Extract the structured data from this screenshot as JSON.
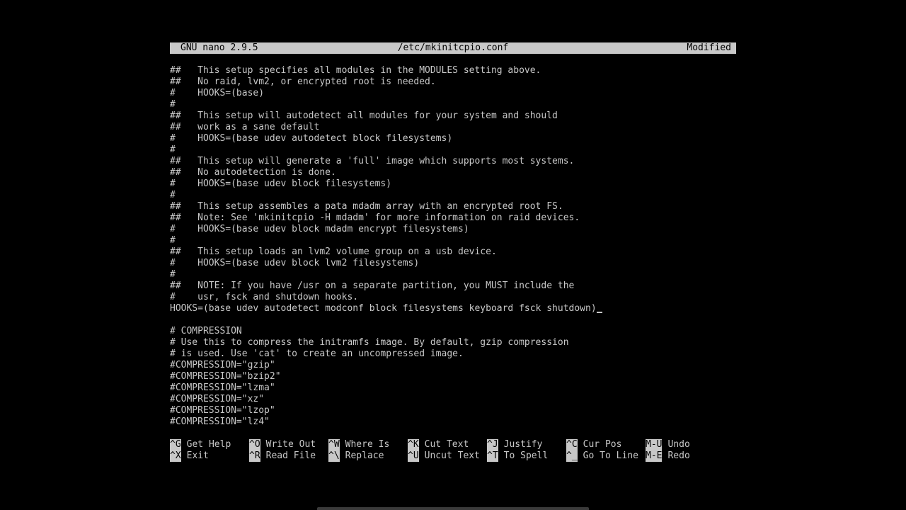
{
  "titlebar": {
    "app": "GNU nano 2.9.5",
    "file": "/etc/mkinitcpio.conf",
    "status": "Modified"
  },
  "editor": {
    "lines": [
      "##   This setup specifies all modules in the MODULES setting above.",
      "##   No raid, lvm2, or encrypted root is needed.",
      "#    HOOKS=(base)",
      "#",
      "##   This setup will autodetect all modules for your system and should",
      "##   work as a sane default",
      "#    HOOKS=(base udev autodetect block filesystems)",
      "#",
      "##   This setup will generate a 'full' image which supports most systems.",
      "##   No autodetection is done.",
      "#    HOOKS=(base udev block filesystems)",
      "#",
      "##   This setup assembles a pata mdadm array with an encrypted root FS.",
      "##   Note: See 'mkinitcpio -H mdadm' for more information on raid devices.",
      "#    HOOKS=(base udev block mdadm encrypt filesystems)",
      "#",
      "##   This setup loads an lvm2 volume group on a usb device.",
      "#    HOOKS=(base udev block lvm2 filesystems)",
      "#",
      "##   NOTE: If you have /usr on a separate partition, you MUST include the",
      "#    usr, fsck and shutdown hooks.",
      "HOOKS=(base udev autodetect modconf block filesystems keyboard fsck shutdown)",
      "",
      "# COMPRESSION",
      "# Use this to compress the initramfs image. By default, gzip compression",
      "# is used. Use 'cat' to create an uncompressed image.",
      "#COMPRESSION=\"gzip\"",
      "#COMPRESSION=\"bzip2\"",
      "#COMPRESSION=\"lzma\"",
      "#COMPRESSION=\"xz\"",
      "#COMPRESSION=\"lzop\"",
      "#COMPRESSION=\"lz4\""
    ]
  },
  "shortcuts": {
    "row1": [
      {
        "key": "^G",
        "label": "Get Help"
      },
      {
        "key": "^O",
        "label": "Write Out"
      },
      {
        "key": "^W",
        "label": "Where Is"
      },
      {
        "key": "^K",
        "label": "Cut Text"
      },
      {
        "key": "^J",
        "label": "Justify"
      },
      {
        "key": "^C",
        "label": "Cur Pos"
      },
      {
        "key": "M-U",
        "label": "Undo"
      }
    ],
    "row2": [
      {
        "key": "^X",
        "label": "Exit"
      },
      {
        "key": "^R",
        "label": "Read File"
      },
      {
        "key": "^\\",
        "label": "Replace"
      },
      {
        "key": "^U",
        "label": "Uncut Text"
      },
      {
        "key": "^T",
        "label": "To Spell"
      },
      {
        "key": "^_",
        "label": "Go To Line"
      },
      {
        "key": "M-E",
        "label": "Redo"
      }
    ]
  },
  "colors": {
    "background": "#000000",
    "foreground": "#c8c8c8"
  }
}
